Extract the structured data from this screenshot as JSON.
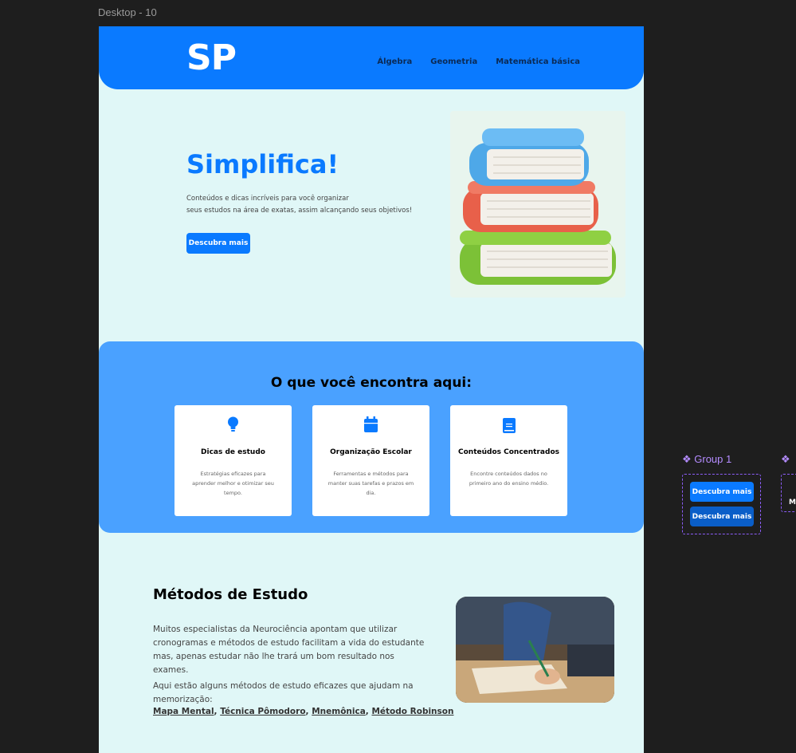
{
  "canvas": {
    "frame_label": "Desktop - 10"
  },
  "header": {
    "logo": "SP",
    "nav": [
      "Álgebra",
      "Geometria",
      "Matemática básica"
    ]
  },
  "hero": {
    "title": "Simplifica!",
    "line1": "Conteúdos e dicas incríveis para você organizar",
    "line2": "seus estudos na área de exatas, assim alcançando seus objetivos!",
    "button": "Descubra mais",
    "image_icon": "books-stack-icon"
  },
  "features": {
    "title": "O que você encontra aqui:",
    "cards": [
      {
        "icon": "lightbulb-icon",
        "title": "Dicas de estudo",
        "text": "Estratégias eficazes para aprender melhor e otimizar seu tempo."
      },
      {
        "icon": "calendar-icon",
        "title": "Organização Escolar",
        "text": "Ferramentas e métodos para manter suas tarefas e prazos em dia."
      },
      {
        "icon": "book-icon",
        "title": "Conteúdos Concentrados",
        "text": "Encontre conteúdos dados no primeiro ano do ensino médio."
      }
    ]
  },
  "metodos": {
    "title": "Métodos de Estudo",
    "p1": "Muitos especialistas da Neurociência apontam que utilizar cronogramas e métodos de estudo facilitam a vida do estudante mas, apenas estudar não lhe trará um bom resultado nos exames.",
    "p2": "Aqui estão alguns métodos de estudo eficazes que ajudam na memorização:",
    "links": [
      "Mapa Mental",
      "Técnica Pômodoro",
      "Mnemônica",
      "Método Robinson"
    ],
    "image_icon": "student-writing-photo"
  },
  "side": {
    "group1_label": "❖ Group 1",
    "group1_buttons": [
      "Descubra mais",
      "Descubra mais"
    ],
    "group2_label": "❖",
    "group2_text": "M"
  },
  "colors": {
    "primary": "#0a7aff",
    "features_bg": "#4aa1ff",
    "page_bg": "#e0f7f7",
    "dark_button": "#0a5ec8"
  }
}
